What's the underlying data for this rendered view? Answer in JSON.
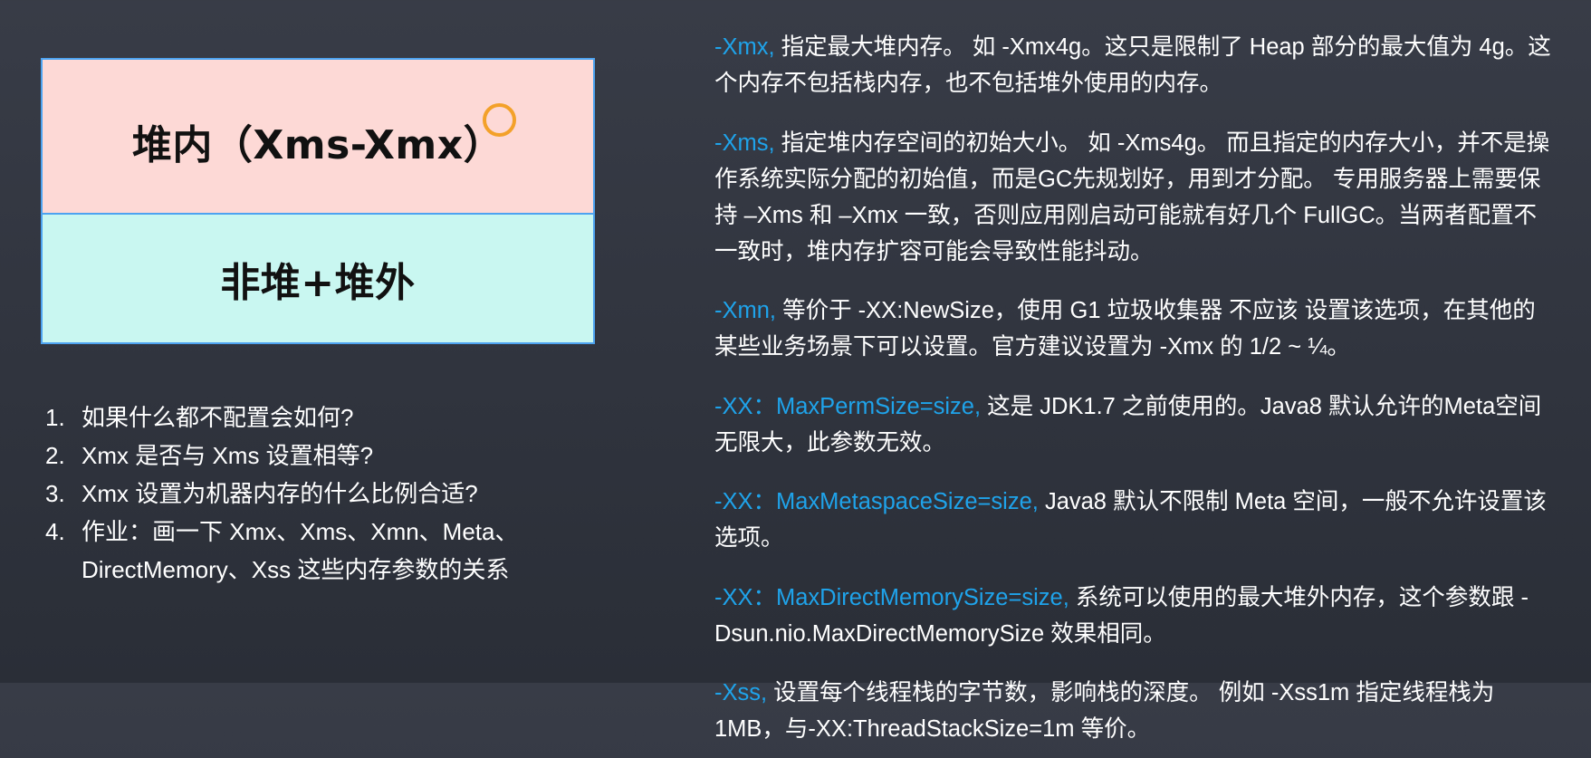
{
  "diagram": {
    "heap_label": "堆内（Xms-Xmx）",
    "nonheap_label": "非堆+堆外"
  },
  "questions": [
    {
      "num": "1.",
      "text": "如果什么都不配置会如何?"
    },
    {
      "num": "2.",
      "text": "Xmx 是否与 Xms 设置相等?"
    },
    {
      "num": "3.",
      "text": "Xmx 设置为机器内存的什么比例合适?"
    },
    {
      "num": "4.",
      "text": "作业：画一下 Xmx、Xms、Xmn、Meta、DirectMemory、Xss 这些内存参数的关系"
    }
  ],
  "params": [
    {
      "name": "-Xmx,",
      "desc": " 指定最大堆内存。 如 -Xmx4g。这只是限制了 Heap 部分的最大值为 4g。这个内存不包括栈内存，也不包括堆外使用的内存。"
    },
    {
      "name": "-Xms,",
      "desc": " 指定堆内存空间的初始大小。 如 -Xms4g。 而且指定的内存大小，并不是操作系统实际分配的初始值，而是GC先规划好，用到才分配。 专用服务器上需要保持 –Xms 和 –Xmx 一致，否则应用刚启动可能就有好几个 FullGC。当两者配置不一致时，堆内存扩容可能会导致性能抖动。"
    },
    {
      "name": "-Xmn,",
      "desc": " 等价于 -XX:NewSize，使用 G1 垃圾收集器 不应该 设置该选项，在其他的某些业务场景下可以设置。官方建议设置为 -Xmx 的 1/2 ~ ¼。"
    },
    {
      "name": "-XX：MaxPermSize=size,",
      "desc": " 这是 JDK1.7 之前使用的。Java8 默认允许的Meta空间无限大，此参数无效。"
    },
    {
      "name": "-XX：MaxMetaspaceSize=size,",
      "desc": " Java8 默认不限制 Meta 空间，一般不允许设置该选项。"
    },
    {
      "name": "-XX：MaxDirectMemorySize=size,",
      "desc": " 系统可以使用的最大堆外内存，这个参数跟 -Dsun.nio.MaxDirectMemorySize 效果相同。"
    },
    {
      "name": "-Xss,",
      "desc": " 设置每个线程栈的字节数，影响栈的深度。 例如 -Xss1m 指定线程栈为 1MB，与-XX:ThreadStackSize=1m 等价。"
    }
  ],
  "colors": {
    "background": "#30343e",
    "param_name": "#1fa3ea",
    "heap_fill": "#fdd9d6",
    "nonheap_fill": "#c9f7f1",
    "border": "#4da3f0",
    "marker": "#f3a12a"
  }
}
